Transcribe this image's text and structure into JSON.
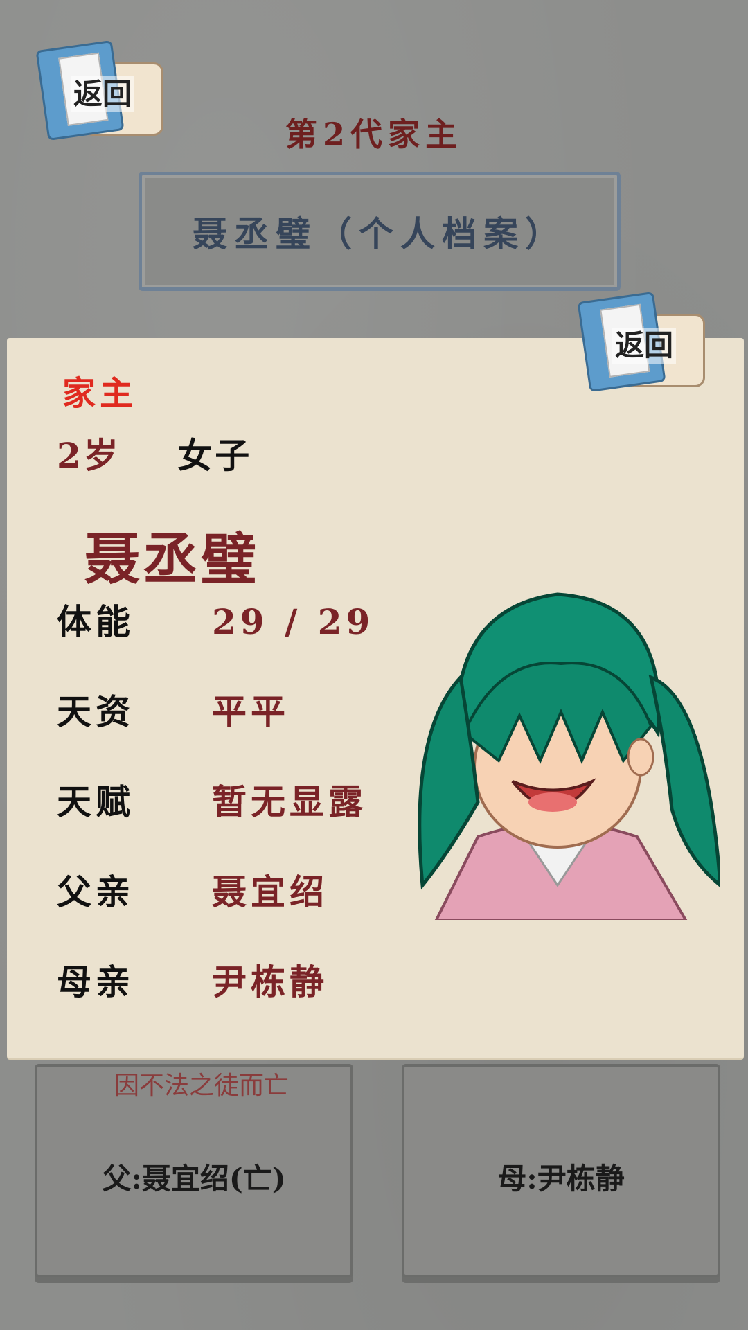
{
  "back_label": "返回",
  "generation_title": "第2代家主",
  "name_banner": "聂丞璧（个人档案）",
  "profile": {
    "role": "家主",
    "age": "2岁",
    "gender": "女子",
    "name": "聂丞璧",
    "stats": [
      {
        "label": "体能",
        "value": "29 / 29"
      },
      {
        "label": "天资",
        "value": "平平"
      },
      {
        "label": "天赋",
        "value": "暂无显露"
      },
      {
        "label": "父亲",
        "value": "聂宜绍"
      },
      {
        "label": "母亲",
        "value": "尹栋静"
      }
    ]
  },
  "parents": {
    "death_note": "因不法之徒而亡",
    "father": "父:聂宜绍(亡)",
    "mother": "母:尹栋静"
  },
  "colors": {
    "accent_red": "#e02a1f",
    "dark_red": "#7a2327",
    "card_bg": "#ebe2cf"
  }
}
